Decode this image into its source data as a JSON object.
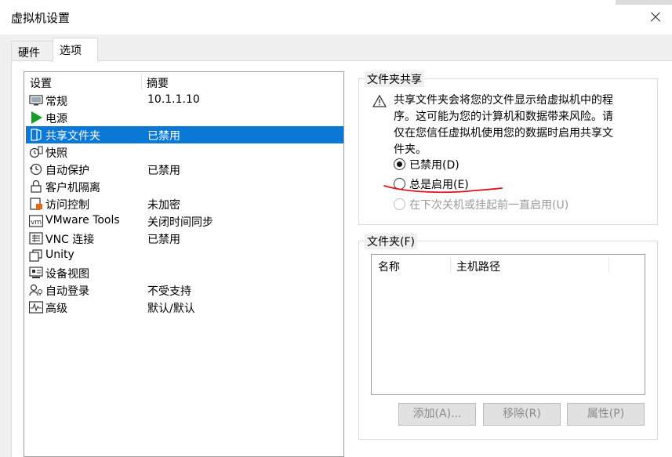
{
  "window": {
    "title": "虚拟机设置"
  },
  "tabs": [
    {
      "label": "硬件",
      "active": false
    },
    {
      "label": "选项",
      "active": true
    }
  ],
  "settings_list": {
    "headers": {
      "setting": "设置",
      "summary": "摘要"
    },
    "items": [
      {
        "name": "常规",
        "summary": "10.1.1.10",
        "icon": "monitor-icon",
        "selected": false
      },
      {
        "name": "电源",
        "summary": "",
        "icon": "play-icon",
        "selected": false
      },
      {
        "name": "共享文件夹",
        "summary": "已禁用",
        "icon": "shared-folder-icon",
        "selected": true
      },
      {
        "name": "快照",
        "summary": "",
        "icon": "snapshot-icon",
        "selected": false
      },
      {
        "name": "自动保护",
        "summary": "已禁用",
        "icon": "clock-icon",
        "selected": false
      },
      {
        "name": "客户机隔离",
        "summary": "",
        "icon": "lock-icon",
        "selected": false
      },
      {
        "name": "访问控制",
        "summary": "未加密",
        "icon": "access-control-icon",
        "selected": false
      },
      {
        "name": "VMware Tools",
        "summary": "关闭时间同步",
        "icon": "vmware-tools-icon",
        "selected": false
      },
      {
        "name": "VNC 连接",
        "summary": "已禁用",
        "icon": "vnc-icon",
        "selected": false
      },
      {
        "name": "Unity",
        "summary": "",
        "icon": "unity-icon",
        "selected": false
      },
      {
        "name": "设备视图",
        "summary": "",
        "icon": "device-view-icon",
        "selected": false
      },
      {
        "name": "自动登录",
        "summary": "不受支持",
        "icon": "autologin-icon",
        "selected": false
      },
      {
        "name": "高级",
        "summary": "默认/默认",
        "icon": "advanced-icon",
        "selected": false
      }
    ]
  },
  "folder_sharing": {
    "legend": "文件夹共享",
    "warning": "共享文件夹会将您的文件显示给虚拟机中的程序。这可能为您的计算机和数据带来风险。请仅在您信任虚拟机使用您的数据时启用共享文件夹。",
    "options": [
      {
        "label": "已禁用(D)",
        "checked": true,
        "disabled": false
      },
      {
        "label": "总是启用(E)",
        "checked": false,
        "disabled": false
      },
      {
        "label": "在下次关机或挂起前一直启用(U)",
        "checked": false,
        "disabled": true
      }
    ]
  },
  "folders": {
    "legend": "文件夹(F)",
    "columns": [
      "名称",
      "主机路径"
    ],
    "buttons": {
      "add": "添加(A)...",
      "remove": "移除(R)",
      "properties": "属性(P)"
    }
  },
  "colors": {
    "selection": "#0a78d7",
    "annotation": "#e0141e"
  }
}
